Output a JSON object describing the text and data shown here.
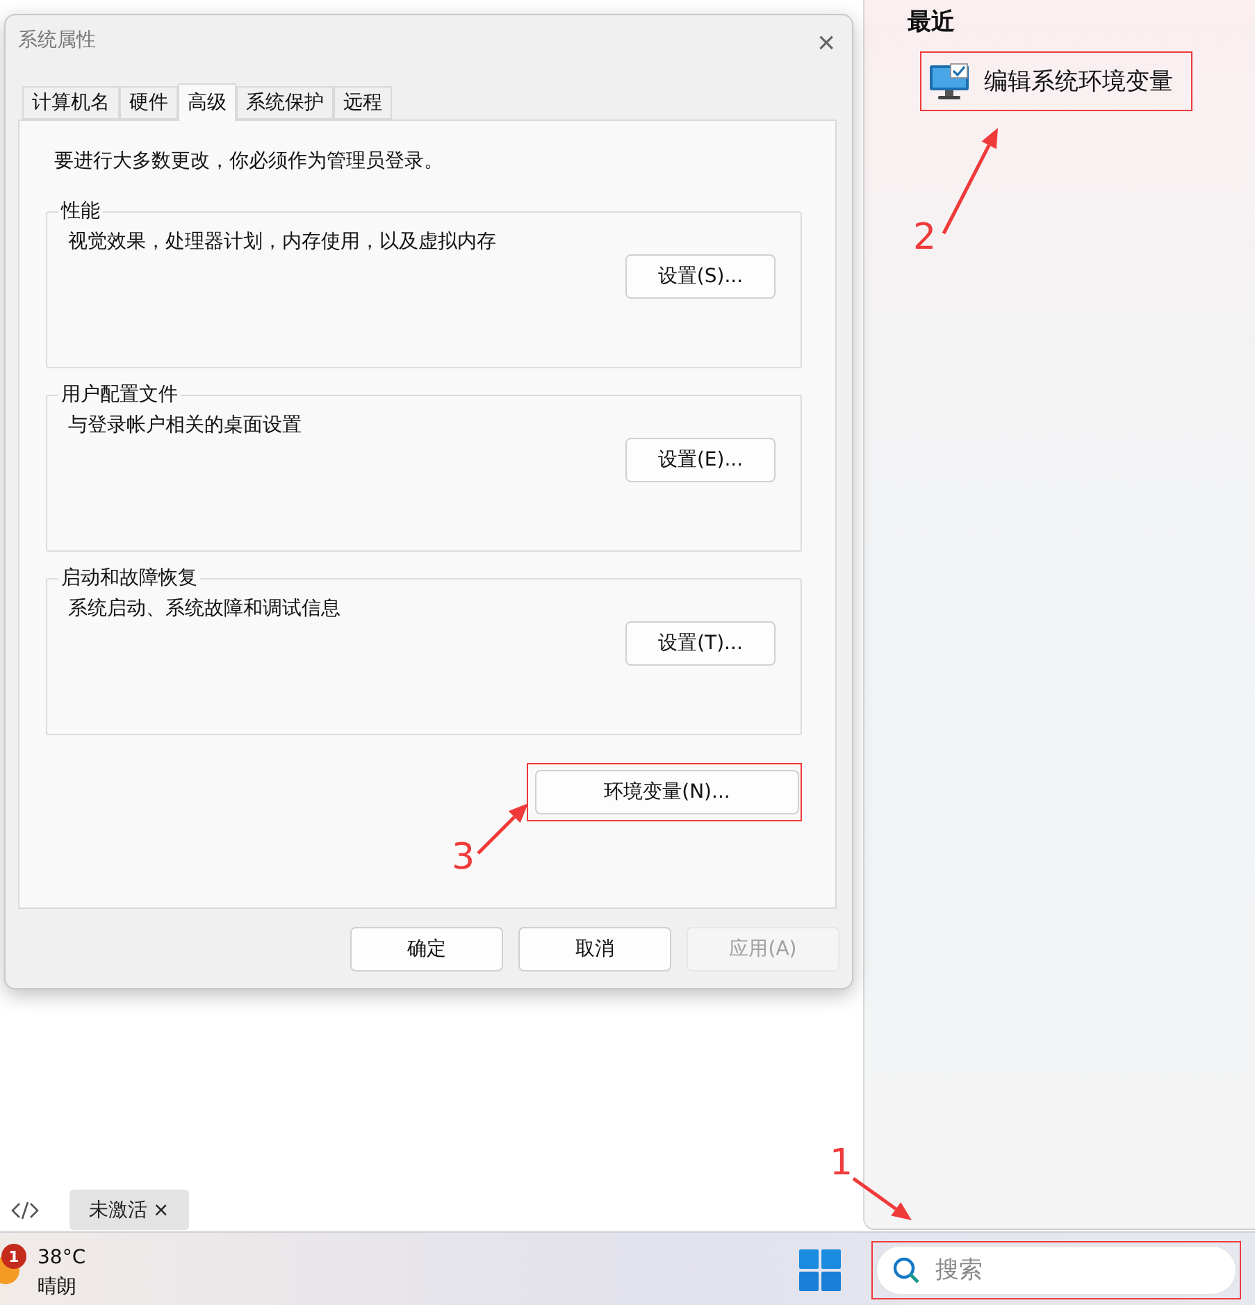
{
  "dialog": {
    "title": "系统属性",
    "close": "×",
    "tabs": [
      {
        "label": "计算机名",
        "selected": false
      },
      {
        "label": "硬件",
        "selected": false
      },
      {
        "label": "高级",
        "selected": true
      },
      {
        "label": "系统保护",
        "selected": false
      },
      {
        "label": "远程",
        "selected": false
      }
    ],
    "notice": "要进行大多数更改，你必须作为管理员登录。",
    "groups": [
      {
        "title": "性能",
        "description": "视觉效果，处理器计划，内存使用，以及虚拟内存",
        "button": "设置(S)..."
      },
      {
        "title": "用户配置文件",
        "description": "与登录帐户相关的桌面设置",
        "button": "设置(E)..."
      },
      {
        "title": "启动和故障恢复",
        "description": "系统启动、系统故障和调试信息",
        "button": "设置(T)..."
      }
    ],
    "env_button": {
      "label": "环境变量(N)...",
      "highlighted": true
    },
    "buttons": [
      {
        "label": "确定",
        "disabled": false
      },
      {
        "label": "取消",
        "disabled": false
      },
      {
        "label": "应用(A)",
        "disabled": true
      }
    ]
  },
  "search_panel": {
    "heading": "最近",
    "results": [
      {
        "label": "编辑系统环境变量",
        "highlighted": true
      }
    ]
  },
  "tag": {
    "label": "未激活",
    "close": "×"
  },
  "taskbar": {
    "weather": {
      "badge": "1",
      "temperature": "38°C",
      "condition": "晴朗"
    },
    "search": {
      "placeholder": "搜索",
      "highlighted": true
    }
  },
  "annotations": [
    {
      "label": "1"
    },
    {
      "label": "2"
    },
    {
      "label": "3"
    }
  ]
}
